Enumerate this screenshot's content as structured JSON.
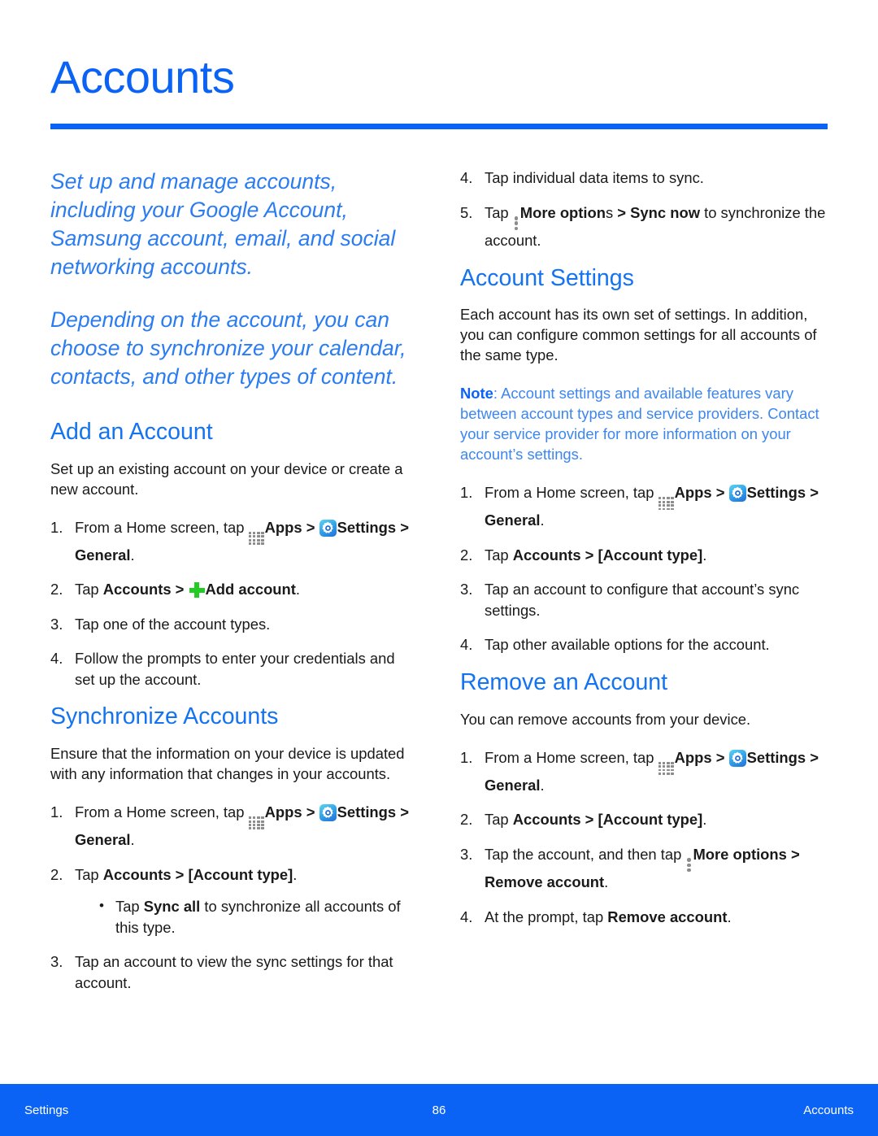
{
  "page": {
    "title": "Accounts",
    "accent_color": "#0b63f6",
    "heading_color": "#1473f0",
    "note_color": "#3c86f0",
    "plus_color": "#22cc22"
  },
  "left_column": {
    "lead_1": "Set up and manage accounts, including your Google Account, Samsung account, email, and social networking accounts.",
    "lead_2": "Depending on the account, you can choose to synchronize your calendar, contacts, and other types of content.",
    "add_account": {
      "heading": "Add an Account",
      "body": "Set up an existing account on your device or create a new account.",
      "steps": [
        {
          "num": "1.",
          "parts": [
            "From a Home screen, tap ",
            "[apps-icon]",
            "Apps",
            " > ",
            "[settings-icon]",
            "Settings",
            " > ",
            "General",
            "."
          ]
        },
        {
          "num": "2.",
          "parts": [
            "Tap ",
            "Accounts",
            " > ",
            "[plus-icon]",
            "Add account",
            "."
          ]
        },
        {
          "num": "3.",
          "text": "Tap one of the account types."
        },
        {
          "num": "4.",
          "text": "Follow the prompts to enter your credentials and set up the account."
        }
      ],
      "step1_pre": "From a Home screen, tap ",
      "step1_apps": "Apps",
      "step1_gt1": " > ",
      "step1_settings": "Settings",
      "step1_gt2": " > ",
      "step1_general": "General",
      "step1_period": ".",
      "step2_pre": "Tap ",
      "step2_accounts": "Accounts",
      "step2_gt": " > ",
      "step2_add": "Add account",
      "step2_period": ".",
      "step3": "Tap one of the account types.",
      "step4": "Follow the prompts to enter your credentials and set up the account."
    },
    "synchronize": {
      "heading": "Synchronize Accounts",
      "body": "Ensure that the information on your device is updated with any information that changes in your accounts.",
      "step1_pre": "From a Home screen, tap ",
      "step1_apps": "Apps",
      "step1_gt1": " > ",
      "step1_settings": "Settings",
      "step1_gt2": " > ",
      "step1_general": "General",
      "step1_period": ".",
      "step2_pre": "Tap ",
      "step2_accounts": "Accounts",
      "step2_gt": " > ",
      "step2_type": "[Account type]",
      "step2_period": ".",
      "bullet_pre": "Tap ",
      "bullet_sync": "Sync all",
      "bullet_post": " to synchronize all accounts of this type.",
      "step3": "Tap an account to view the sync settings for that account."
    }
  },
  "right_column": {
    "sync_continued": {
      "step4": "Tap individual data items to sync.",
      "step5_pre": "Tap ",
      "step5_more": "More option",
      "step5_more_tail": "s",
      "step5_gt": " > ",
      "step5_syncnow": "Sync now",
      "step5_post": " to synchronize the account."
    },
    "account_settings": {
      "heading": "Account Settings",
      "body": "Each account has its own set of settings. In addition, you can configure common settings for all accounts of the same type.",
      "note_label": "Note",
      "note_text": ": Account settings and available features vary between account types and service providers. Contact your service provider for more information on your account’s settings.",
      "step1_pre": "From a Home screen, tap ",
      "step1_apps": "Apps",
      "step1_gt1": " > ",
      "step1_settings": "Settings",
      "step1_gt2": " > ",
      "step1_general": "General",
      "step1_period": ".",
      "step2_pre": "Tap ",
      "step2_accounts": "Accounts",
      "step2_gt": " > ",
      "step2_type": "[Account type]",
      "step2_period": ".",
      "step3": "Tap an account to configure that account’s sync settings.",
      "step4": "Tap other available options for the account."
    },
    "remove_account": {
      "heading": "Remove an Account",
      "body": "You can remove accounts from your device.",
      "step1_pre": "From a Home screen, tap ",
      "step1_apps": "Apps",
      "step1_gt1": " > ",
      "step1_settings": "Settings",
      "step1_gt2": " > ",
      "step1_general": "General",
      "step1_period": ".",
      "step2_pre": "Tap ",
      "step2_accounts": "Accounts",
      "step2_gt": " > ",
      "step2_type": "[Account type]",
      "step2_period": ".",
      "step3_pre": "Tap the account, and then tap ",
      "step3_more": "More options",
      "step3_gt": " > ",
      "step3_remove": "Remove account",
      "step3_period": ".",
      "step4_pre": "At the prompt, tap ",
      "step4_remove": "Remove account",
      "step4_period": "."
    }
  },
  "footer": {
    "left": "Settings",
    "page_number": "86",
    "right": "Accounts"
  },
  "step_numbers": {
    "n1": "1.",
    "n2": "2.",
    "n3": "3.",
    "n4": "4.",
    "n5": "5.",
    "bullet": "•"
  }
}
